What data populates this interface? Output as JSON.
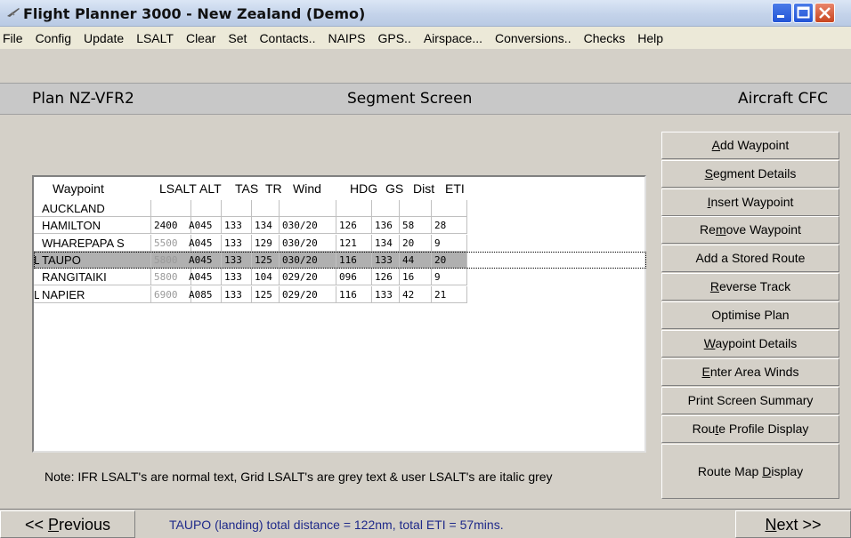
{
  "window": {
    "title": "Flight Planner 3000 - New Zealand (Demo)"
  },
  "menu": [
    "File",
    "Config",
    "Update",
    "LSALT",
    "Clear",
    "Set",
    "Contacts..",
    "NAIPS",
    "GPS..",
    "Airspace...",
    "Conversions..",
    "Checks",
    "Help"
  ],
  "header": {
    "plan": "Plan NZ-VFR2",
    "screen": "Segment Screen",
    "aircraft": "Aircraft CFC"
  },
  "grid": {
    "columns": [
      "Waypoint",
      "LSALT",
      "ALT",
      "TAS",
      "TR",
      "Wind",
      "HDG",
      "GS",
      "Dist",
      "ETI"
    ],
    "rows": [
      {
        "marker": "",
        "waypoint": "AUCKLAND",
        "lsalt": "",
        "alt": "",
        "tas": "",
        "tr": "",
        "wind": "",
        "hdg": "",
        "gs": "",
        "dist": "",
        "eti": ""
      },
      {
        "marker": "",
        "waypoint": "HAMILTON",
        "lsalt": "2400",
        "alt": "A045",
        "tas": "133",
        "tr": "134",
        "wind": "030/20",
        "hdg": "126",
        "gs": "136",
        "dist": "58",
        "eti": "28"
      },
      {
        "marker": "",
        "waypoint": "WHAREPAPA S",
        "lsalt": "5500",
        "alt": "A045",
        "tas": "133",
        "tr": "129",
        "wind": "030/20",
        "hdg": "121",
        "gs": "134",
        "dist": "20",
        "eti": "9"
      },
      {
        "marker": "L",
        "waypoint": "TAUPO",
        "lsalt": "5800",
        "alt": "A045",
        "tas": "133",
        "tr": "125",
        "wind": "030/20",
        "hdg": "116",
        "gs": "133",
        "dist": "44",
        "eti": "20"
      },
      {
        "marker": "",
        "waypoint": "RANGITAIKI",
        "lsalt": "5800",
        "alt": "A045",
        "tas": "133",
        "tr": "104",
        "wind": "029/20",
        "hdg": "096",
        "gs": "126",
        "dist": "16",
        "eti": "9"
      },
      {
        "marker": "L",
        "waypoint": "NAPIER",
        "lsalt": "6900",
        "alt": "A085",
        "tas": "133",
        "tr": "125",
        "wind": "029/20",
        "hdg": "116",
        "gs": "133",
        "dist": "42",
        "eti": "21"
      }
    ]
  },
  "buttons": [
    {
      "pre": "",
      "u": "A",
      "post": "dd Waypoint"
    },
    {
      "pre": "",
      "u": "S",
      "post": "egment Details"
    },
    {
      "pre": "",
      "u": "I",
      "post": "nsert Waypoint"
    },
    {
      "pre": "Re",
      "u": "m",
      "post": "ove Waypoint"
    },
    {
      "pre": "Add a Stored Route",
      "u": "",
      "post": ""
    },
    {
      "pre": "",
      "u": "R",
      "post": "everse Track"
    },
    {
      "pre": "Optimise Plan",
      "u": "",
      "post": ""
    },
    {
      "pre": "",
      "u": "W",
      "post": "aypoint Details"
    },
    {
      "pre": "",
      "u": "E",
      "post": "nter Area Winds"
    },
    {
      "pre": "Print Screen Summary",
      "u": "",
      "post": ""
    },
    {
      "pre": "Rou",
      "u": "t",
      "post": "e Profile Display"
    },
    {
      "pre": "Route Map ",
      "u": "D",
      "post": "isplay"
    }
  ],
  "note": "Note: IFR LSALT's are normal text, Grid LSALT's are grey text & user LSALT's are italic grey",
  "footer": {
    "prev": {
      "pre": "<< ",
      "u": "P",
      "post": "revious"
    },
    "next": {
      "pre": "",
      "u": "N",
      "post": "ext >>"
    },
    "status": "TAUPO (landing) total distance = 122nm, total ETI = 57mins."
  },
  "colors": {
    "selected_row": "#b0b0b0",
    "grey_lsalt": "#9a9a9a",
    "status_text": "#1f2a8a"
  }
}
